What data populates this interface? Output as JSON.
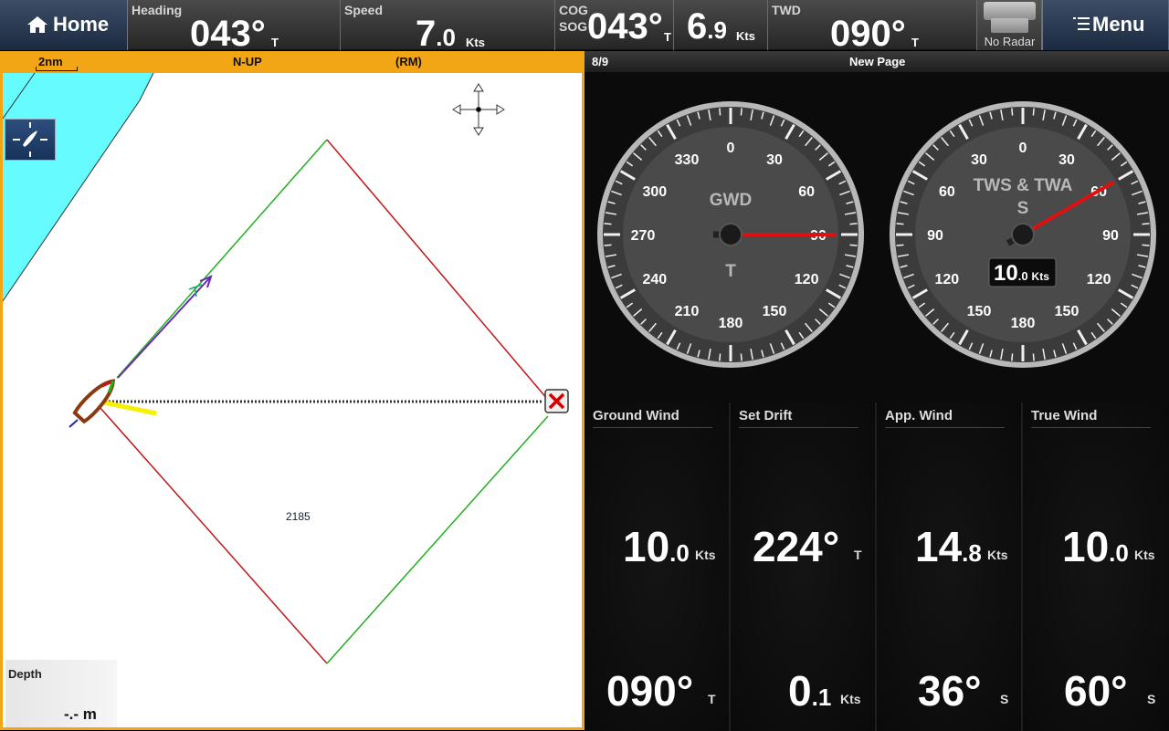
{
  "topbar": {
    "home": "Home",
    "heading": {
      "label": "Heading",
      "value": "043°",
      "unit": "T"
    },
    "speed": {
      "label": "Speed",
      "value": "7",
      "decimal": ".0",
      "unit": "Kts"
    },
    "cog": {
      "label": "COG",
      "value": "043°",
      "unit": "T"
    },
    "sog": {
      "label": "SOG",
      "value": "6",
      "decimal": ".9",
      "unit": "Kts"
    },
    "twd": {
      "label": "TWD",
      "value": "090°",
      "unit": "T"
    },
    "radar": "No Radar",
    "menu": "Menu"
  },
  "chart": {
    "scale": "2nm",
    "orientation": "N-UP",
    "motion": "(RM)",
    "waypoint_label": "2185",
    "depth": {
      "label": "Depth",
      "value": "-.- m"
    }
  },
  "dashboard": {
    "page_num": "8/9",
    "page_name": "New Page",
    "gauge_gwd": {
      "title": "GWD",
      "subtitle": "T",
      "ticks": [
        "0",
        "30",
        "60",
        "90",
        "120",
        "150",
        "180",
        "210",
        "240",
        "270",
        "300",
        "330"
      ],
      "needle_deg": 90
    },
    "gauge_tws": {
      "title": "TWS & TWA",
      "subtitle": "S",
      "ticks": [
        "0",
        "30",
        "60",
        "90",
        "120",
        "150",
        "180",
        "150",
        "120",
        "90",
        "60",
        "30"
      ],
      "speed": "10",
      "speed_decimal": ".0",
      "speed_unit": "Kts",
      "needle_deg": 60
    },
    "tiles": [
      {
        "title": "Ground Wind",
        "v1": "10",
        "v1d": ".0",
        "u1": "Kts",
        "v2": "090°",
        "v2d": "",
        "u2": "T"
      },
      {
        "title": "Set Drift",
        "v1": "224°",
        "v1d": "",
        "u1": "T",
        "v2": "0",
        "v2d": ".1",
        "u2": "Kts"
      },
      {
        "title": "App. Wind",
        "v1": "14",
        "v1d": ".8",
        "u1": "Kts",
        "v2": "36°",
        "v2d": "",
        "u2": "S"
      },
      {
        "title": "True Wind",
        "v1": "10",
        "v1d": ".0",
        "u1": "Kts",
        "v2": "60°",
        "v2d": "",
        "u2": "S"
      }
    ]
  },
  "colors": {
    "accent": "#f2a515",
    "land": "#66fbff",
    "route_red": "#c01818",
    "route_green": "#20b020",
    "needle": "#e01010"
  }
}
